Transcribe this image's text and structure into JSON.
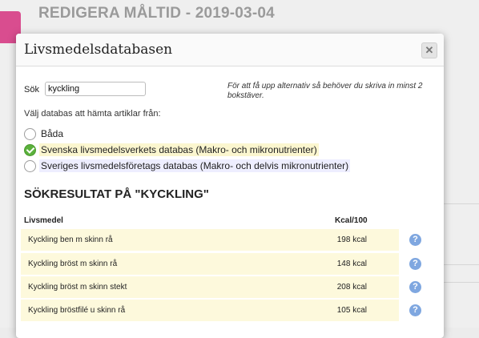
{
  "background": {
    "title": "REDIGERA MÅLTID - 2019-03-04"
  },
  "modal": {
    "title": "Livsmedelsdatabasen",
    "close_icon": "close-icon",
    "search": {
      "label": "Sök",
      "value": "kyckling"
    },
    "hint": "För att få upp alternativ så behöver du skriva in minst 2 bokstäver.",
    "db_label": "Välj databas att hämta artiklar från:",
    "options": [
      {
        "label": "Båda",
        "selected": false
      },
      {
        "label": "Svenska livsmedelsverkets databas (Makro- och mikronutrienter)",
        "selected": true
      },
      {
        "label": "Sveriges livsmedelsföretags databas (Makro- och delvis mikronutrienter)",
        "selected": false
      }
    ],
    "results_heading": "SÖKRESULTAT PÅ \"KYCKLING\"",
    "table": {
      "headers": [
        "Livsmedel",
        "Kcal/100"
      ],
      "rows": [
        {
          "name": "Kyckling ben m skinn rå",
          "kcal": "198 kcal"
        },
        {
          "name": "Kyckling bröst m skinn rå",
          "kcal": "148 kcal"
        },
        {
          "name": "Kyckling bröst m skinn stekt",
          "kcal": "208 kcal"
        },
        {
          "name": "Kyckling bröstfilé u skinn rå",
          "kcal": "105 kcal"
        }
      ],
      "help_icon": "question-icon",
      "help_glyph": "?"
    },
    "colors": {
      "accent_green": "#5bb13c",
      "row_highlight": "#fdf9dc",
      "help_blue": "#7fa7e0",
      "brand_pink": "#d94d8f"
    }
  }
}
